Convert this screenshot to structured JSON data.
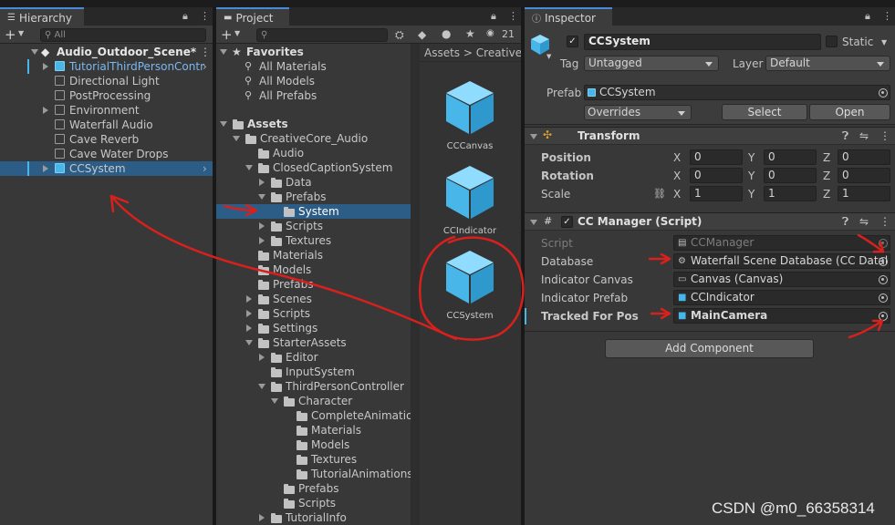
{
  "hierarchy": {
    "tab": "Hierarchy",
    "search_placeholder": "All",
    "scene": "Audio_Outdoor_Scene*",
    "items": [
      {
        "label": "TutorialThirdPersonContr",
        "expandable": true,
        "prefab": true
      },
      {
        "label": "Directional Light"
      },
      {
        "label": "PostProcessing"
      },
      {
        "label": "Environment",
        "expandable": true
      },
      {
        "label": "Waterfall Audio"
      },
      {
        "label": "Cave Reverb"
      },
      {
        "label": "Cave Water Drops"
      },
      {
        "label": "CCSystem",
        "expandable": true,
        "selected": true,
        "prefab": true
      }
    ]
  },
  "project": {
    "tab": "Project",
    "count": "21",
    "favorites": {
      "label": "Favorites",
      "items": [
        "All Materials",
        "All Models",
        "All Prefabs"
      ]
    },
    "tree": {
      "root": "Assets",
      "rows": [
        {
          "label": "CreativeCore_Audio"
        },
        {
          "label": "Audio"
        },
        {
          "label": "ClosedCaptionSystem"
        },
        {
          "label": "Data"
        },
        {
          "label": "Prefabs"
        },
        {
          "label": "System",
          "selected": true
        },
        {
          "label": "Scripts"
        },
        {
          "label": "Textures"
        },
        {
          "label": "Materials"
        },
        {
          "label": "Models"
        },
        {
          "label": "Prefabs"
        },
        {
          "label": "Scenes"
        },
        {
          "label": "Scripts"
        },
        {
          "label": "Settings"
        },
        {
          "label": "StarterAssets"
        },
        {
          "label": "Editor"
        },
        {
          "label": "InputSystem"
        },
        {
          "label": "ThirdPersonController"
        },
        {
          "label": "Character"
        },
        {
          "label": "CompleteAnimation"
        },
        {
          "label": "Materials"
        },
        {
          "label": "Models"
        },
        {
          "label": "Textures"
        },
        {
          "label": "TutorialAnimations"
        },
        {
          "label": "Prefabs"
        },
        {
          "label": "Scripts"
        },
        {
          "label": "TutorialInfo"
        }
      ]
    },
    "breadcrumb": [
      "Assets",
      "CreativeC"
    ],
    "assets": [
      "CCCanvas",
      "CCIndicator",
      "CCSystem"
    ]
  },
  "inspector": {
    "tab": "Inspector",
    "object_name": "CCSystem",
    "static_label": "Static",
    "tag_label": "Tag",
    "tag_value": "Untagged",
    "layer_label": "Layer",
    "layer_value": "Default",
    "prefab_label": "Prefab",
    "prefab_value": "CCSystem",
    "overrides": "Overrides",
    "select": "Select",
    "open": "Open",
    "transform": {
      "title": "Transform",
      "rows": [
        {
          "label": "Position",
          "x": "0",
          "y": "0",
          "z": "0"
        },
        {
          "label": "Rotation",
          "x": "0",
          "y": "0",
          "z": "0"
        },
        {
          "label": "Scale",
          "x": "1",
          "y": "1",
          "z": "1"
        }
      ],
      "axis_x": "X",
      "axis_y": "Y",
      "axis_z": "Z"
    },
    "cc_manager": {
      "title": "CC Manager (Script)",
      "fields": [
        {
          "label": "Script",
          "value": "CCManager"
        },
        {
          "label": "Database",
          "value": "Waterfall Scene Database (CC Datal"
        },
        {
          "label": "Indicator Canvas",
          "value": "Canvas (Canvas)"
        },
        {
          "label": "Indicator Prefab",
          "value": "CCIndicator"
        },
        {
          "label": "Tracked For Pos",
          "value": "MainCamera"
        }
      ]
    },
    "add_component": "Add Component"
  },
  "watermark": "CSDN @m0_66358314",
  "colors": {
    "selection": "#2c5d87",
    "accent": "#4a8adb",
    "annotation": "#d8201c",
    "prefab": "#48b6e8"
  }
}
